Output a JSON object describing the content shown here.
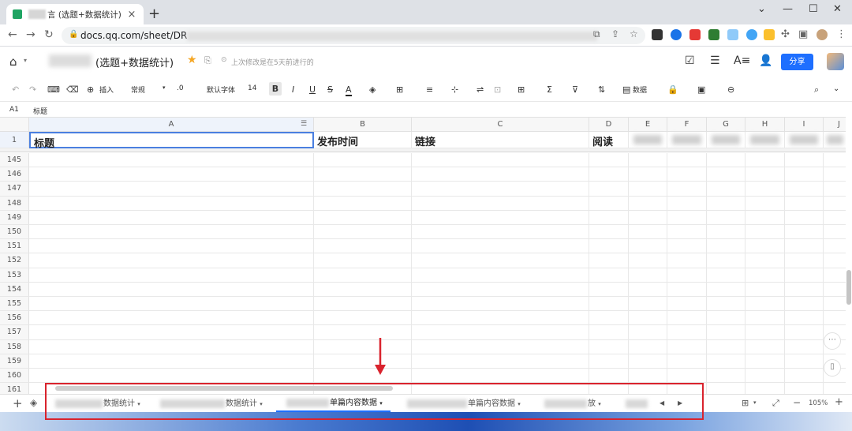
{
  "browser": {
    "tab_title": "言 (选题+数据统计)",
    "url": "docs.qq.com/sheet/DR"
  },
  "app": {
    "doc_title": "(选题+数据统计)",
    "save_status": "上次修改是在5天前进行的",
    "share_label": "分享"
  },
  "toolbar": {
    "insert_label": "插入",
    "format_label": "常规",
    "decimal_label": ".0",
    "font_label": "默认字体",
    "size_label": "14",
    "bold_label": "B",
    "italic_label": "I",
    "underline_label": "U",
    "strike_label": "S",
    "color_label": "A",
    "data_label": "数据"
  },
  "formula_bar": {
    "cell_ref": "A1",
    "content": "标题"
  },
  "columns": [
    "A",
    "B",
    "C",
    "D",
    "E",
    "F",
    "G",
    "H",
    "I",
    "J"
  ],
  "header_row": {
    "row_number": "1",
    "A": "标题",
    "B": "发布时间",
    "C": "链接",
    "D": "阅读"
  },
  "row_numbers": [
    "145",
    "146",
    "147",
    "148",
    "149",
    "150",
    "151",
    "152",
    "153",
    "154",
    "155",
    "156",
    "157",
    "158",
    "159",
    "160",
    "161"
  ],
  "sheet_tabs": [
    {
      "label": "数据统计"
    },
    {
      "label": "数据统计"
    },
    {
      "label": "单篇内容数据"
    },
    {
      "label": "单篇内容数据"
    },
    {
      "label": "放"
    }
  ],
  "zoom": "105%",
  "colors": {
    "accent": "#1e6fff",
    "annotation": "#d9232d"
  }
}
